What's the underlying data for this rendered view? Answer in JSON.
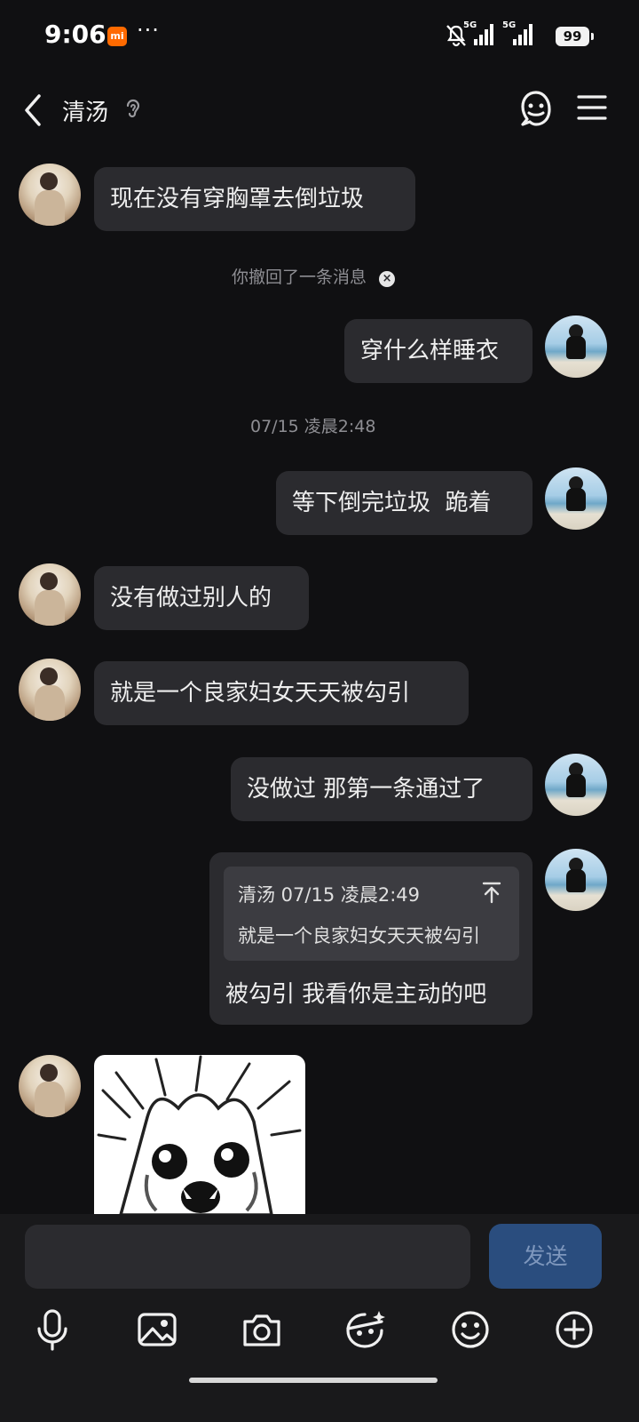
{
  "status_bar": {
    "time": "9:06",
    "battery": "99",
    "network_1": "5G",
    "network_2": "5G"
  },
  "header": {
    "title": "清汤",
    "back_icon": "chevron-left-icon",
    "ear_icon": "ear-icon",
    "qq_icon": "qq-penguin-icon",
    "menu_icon": "hamburger-menu-icon"
  },
  "messages": [
    {
      "sender": "her",
      "text": "现在没有穿胸罩去倒垃圾"
    },
    {
      "sender": "system",
      "text": "你撤回了一条消息"
    },
    {
      "sender": "me",
      "text": "穿什么样睡衣"
    },
    {
      "sender": "system",
      "text": "07/15 凌晨2:48"
    },
    {
      "sender": "me",
      "text": "等下倒完垃圾  跪着"
    },
    {
      "sender": "her",
      "text": "没有做过别人的"
    },
    {
      "sender": "her",
      "text": "就是一个良家妇女天天被勾引"
    },
    {
      "sender": "me",
      "text": "没做过 那第一条通过了"
    },
    {
      "sender": "me",
      "quote_header": "清汤 07/15 凌晨2:49",
      "quote_text": "就是一个良家妇女天天被勾引",
      "text": "被勾引 我看你是主动的吧"
    },
    {
      "sender": "her",
      "type": "sticker",
      "sticker_icon": "crying-cat-sticker-icon"
    }
  ],
  "input": {
    "value": "",
    "placeholder": ""
  },
  "send_label": "发送",
  "toolbar": [
    "microphone-icon",
    "image-icon",
    "camera-icon",
    "emoji-face-icon",
    "smile-icon",
    "plus-circle-icon"
  ],
  "colors": {
    "background": "#101012",
    "bubble": "#2b2b2f",
    "send_button": "#2a4d7e",
    "send_text": "#7e97bd"
  }
}
